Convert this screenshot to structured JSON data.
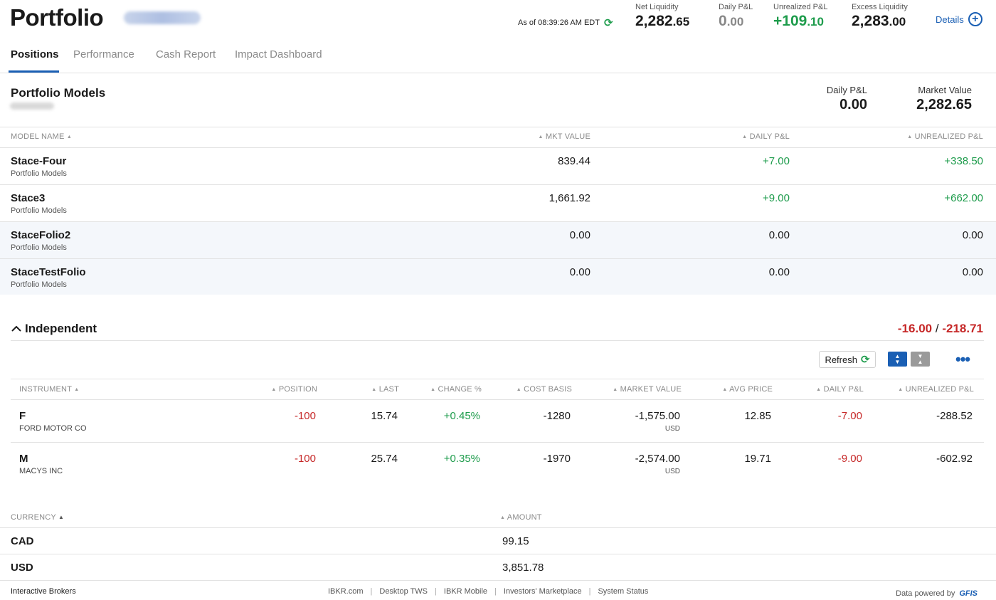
{
  "header": {
    "title": "Portfolio",
    "as_of": "As of 08:39:26 AM EDT",
    "metrics": [
      {
        "label": "Net Liquidity",
        "int": "2,282",
        "dec": ".65",
        "tone": "default"
      },
      {
        "label": "Daily P&L",
        "int": "0",
        "dec": ".00",
        "tone": "gray"
      },
      {
        "label": "Unrealized P&L",
        "int": "+109",
        "dec": ".10",
        "tone": "green"
      },
      {
        "label": "Excess Liquidity",
        "int": "2,283",
        "dec": ".00",
        "tone": "default"
      }
    ],
    "details_label": "Details"
  },
  "tabs": [
    "Positions",
    "Performance",
    "Cash Report",
    "Impact Dashboard"
  ],
  "portfolio_models": {
    "title": "Portfolio Models",
    "summary": [
      {
        "label": "Daily P&L",
        "value": "0.00"
      },
      {
        "label": "Market Value",
        "value": "2,282.65"
      }
    ],
    "columns": [
      "MODEL NAME",
      "MKT VALUE",
      "DAILY P&L",
      "UNREALIZED P&L"
    ],
    "rows": [
      {
        "name": "Stace-Four",
        "sub": "Portfolio Models",
        "mkt": "839.44",
        "daily": "+7.00",
        "unreal": "+338.50"
      },
      {
        "name": "Stace3",
        "sub": "Portfolio Models",
        "mkt": "1,661.92",
        "daily": "+9.00",
        "unreal": "+662.00"
      },
      {
        "name": "StaceFolio2",
        "sub": "Portfolio Models",
        "mkt": "0.00",
        "daily": "0.00",
        "unreal": "0.00"
      },
      {
        "name": "StaceTestFolio",
        "sub": "Portfolio Models",
        "mkt": "0.00",
        "daily": "0.00",
        "unreal": "0.00"
      }
    ]
  },
  "independent": {
    "title": "Independent",
    "total_daily": "-16.00",
    "total_sep": "/",
    "total_unreal": "-218.71",
    "refresh_label": "Refresh",
    "columns": [
      "INSTRUMENT",
      "POSITION",
      "LAST",
      "CHANGE %",
      "COST BASIS",
      "MARKET VALUE",
      "AVG PRICE",
      "DAILY P&L",
      "UNREALIZED P&L"
    ],
    "rows": [
      {
        "symbol": "F",
        "desc": "FORD MOTOR CO",
        "position": "-100",
        "last": "15.74",
        "change": "+0.45%",
        "cost": "-1280",
        "mkt": "-1,575.00",
        "ccy": "USD",
        "avg": "12.85",
        "daily": "-7.00",
        "unreal": "-288.52"
      },
      {
        "symbol": "M",
        "desc": "MACYS INC",
        "position": "-100",
        "last": "25.74",
        "change": "+0.35%",
        "cost": "-1970",
        "mkt": "-2,574.00",
        "ccy": "USD",
        "avg": "19.71",
        "daily": "-9.00",
        "unreal": "-602.92"
      }
    ]
  },
  "currency": {
    "columns": [
      "CURRENCY",
      "AMOUNT"
    ],
    "rows": [
      {
        "code": "CAD",
        "amount": "99.15"
      },
      {
        "code": "USD",
        "amount": "3,851.78"
      }
    ]
  },
  "footer": {
    "brand": "Interactive Brokers",
    "links": [
      "IBKR.com",
      "Desktop TWS",
      "IBKR Mobile",
      "Investors' Marketplace",
      "System Status"
    ],
    "powered_by": "Data powered by",
    "provider": "GFIS"
  },
  "colors": {
    "accent": "#1a5fb4",
    "positive": "#1e9c4c",
    "negative": "#c62828"
  },
  "icons": [
    "refresh-icon",
    "plus-circle-icon",
    "chevron-up-icon",
    "sort-ascending-icon",
    "expand-icon",
    "collapse-icon",
    "more-icon"
  ]
}
